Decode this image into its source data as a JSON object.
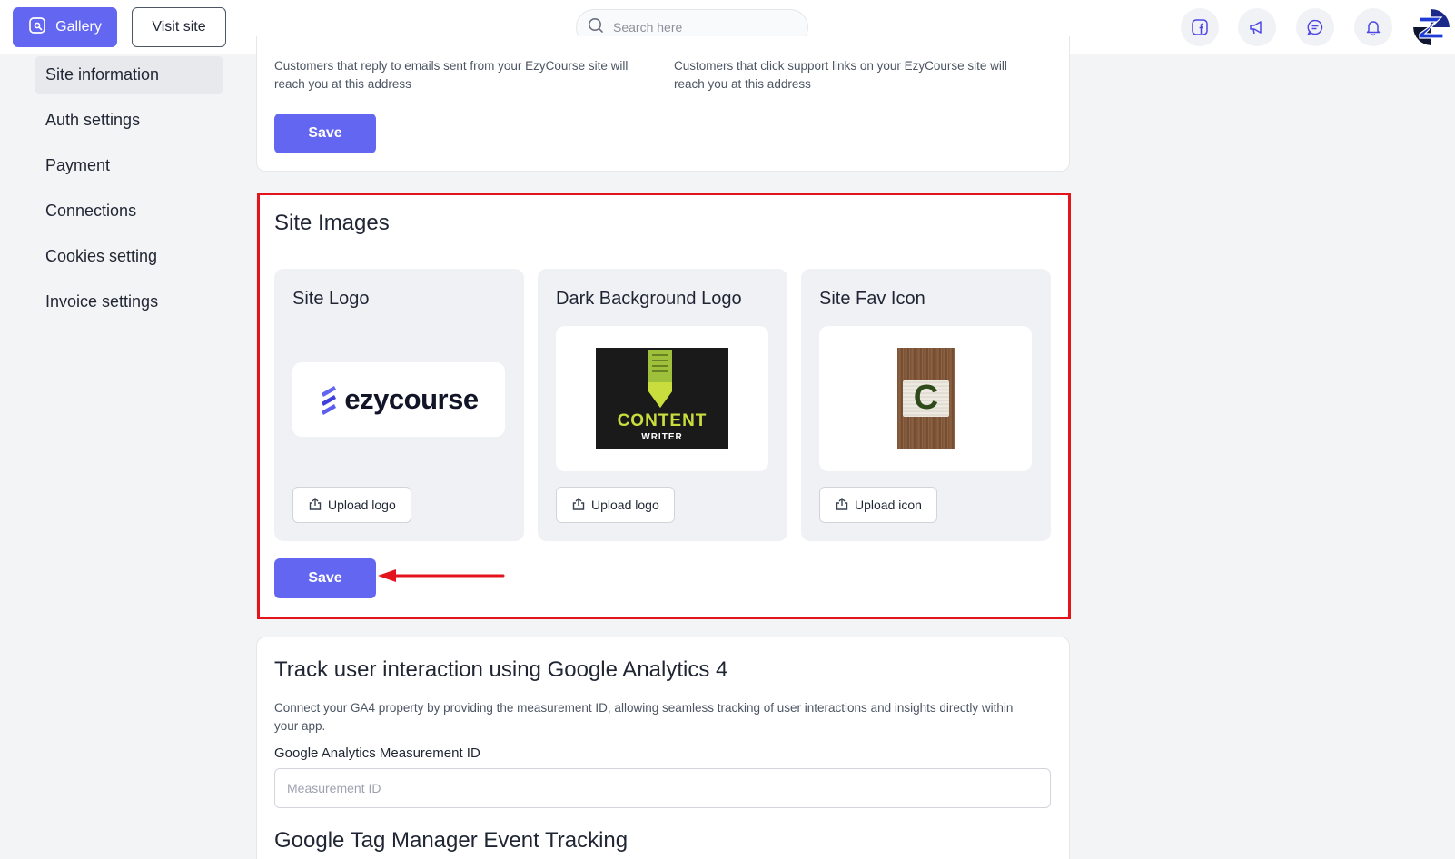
{
  "topbar": {
    "gallery_label": "Gallery",
    "visit_label": "Visit site",
    "search_placeholder": "Search here"
  },
  "sidebar": {
    "items": [
      {
        "label": "Site information",
        "active": true
      },
      {
        "label": "Auth settings"
      },
      {
        "label": "Payment"
      },
      {
        "label": "Connections"
      },
      {
        "label": "Cookies setting"
      },
      {
        "label": "Invoice settings"
      }
    ]
  },
  "email_section": {
    "reply_hint": "Customers that reply to emails sent from your EzyCourse site will reach you at this address",
    "support_hint": "Customers that click support links on your EzyCourse site will reach you at this address",
    "save_label": "Save"
  },
  "site_images": {
    "title": "Site Images",
    "panels": [
      {
        "title": "Site Logo",
        "logo_text": "ezycourse",
        "upload_label": "Upload logo"
      },
      {
        "title": "Dark Background Logo",
        "logo_line1": "CONTENT",
        "logo_line2": "WRITER",
        "upload_label": "Upload logo"
      },
      {
        "title": "Site Fav Icon",
        "logo_letter": "C",
        "upload_label": "Upload icon"
      }
    ],
    "save_label": "Save"
  },
  "analytics": {
    "title": "Track user interaction using Google Analytics 4",
    "description": "Connect your GA4 property by providing the measurement ID, allowing seamless tracking of user interactions and insights directly within your app.",
    "field_label": "Google Analytics Measurement ID",
    "field_placeholder": "Measurement ID",
    "gtm_title": "Google Tag Manager Event Tracking"
  },
  "colors": {
    "accent": "#6366f1",
    "highlight": "#e3141b",
    "panel_bg": "#f0f1f5"
  }
}
